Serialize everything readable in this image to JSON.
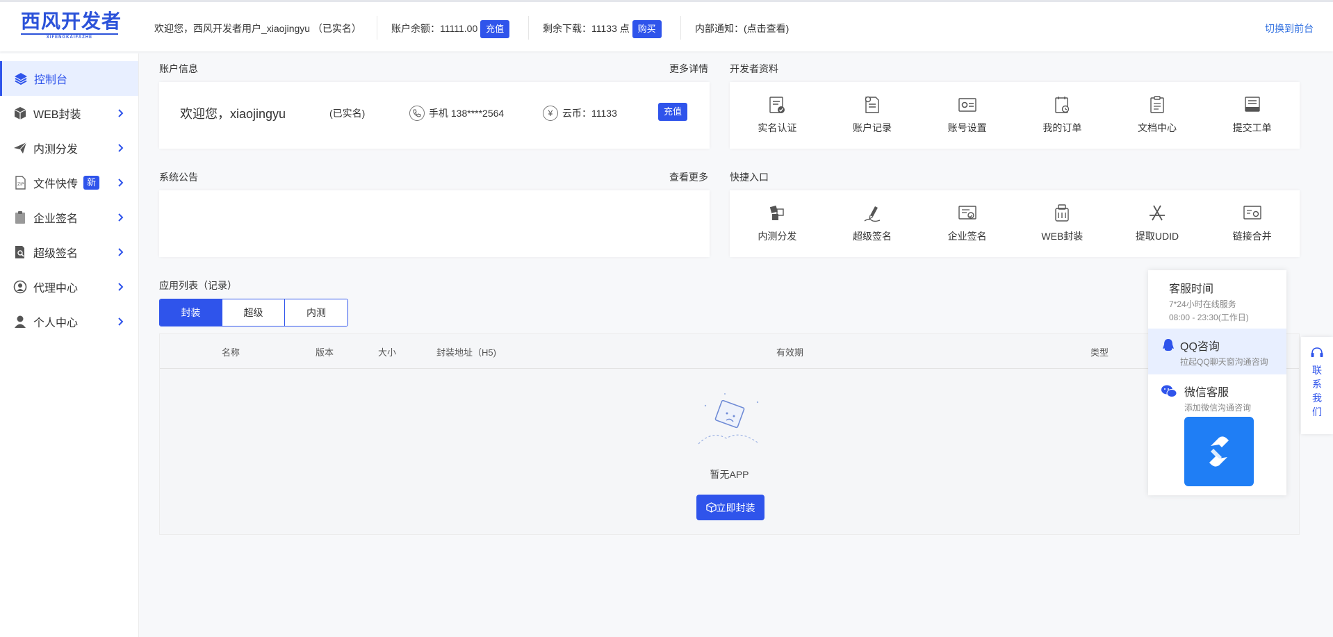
{
  "header": {
    "logo_title": "西风开发者",
    "logo_sub": "XIFENGKAIFAZHE",
    "welcome": "欢迎您，西风开发者用户_xiaojingyu （已实名）",
    "balance_label": "账户余额：11111.00",
    "recharge_btn": "充值",
    "downloads_label": "剩余下载：11133 点",
    "buy_btn": "购买",
    "notice": "内部通知：(点击查看)",
    "switch_front": "切换到前台"
  },
  "sidebar": {
    "items": [
      {
        "label": "控制台",
        "icon": "layers-icon"
      },
      {
        "label": "WEB封装",
        "icon": "box-icon"
      },
      {
        "label": "内测分发",
        "icon": "paper-plane-icon"
      },
      {
        "label": "文件快传",
        "icon": "file-transfer-icon",
        "badge": "新"
      },
      {
        "label": "企业签名",
        "icon": "clipboard-icon"
      },
      {
        "label": "超级签名",
        "icon": "document-search-icon"
      },
      {
        "label": "代理中心",
        "icon": "agent-icon"
      },
      {
        "label": "个人中心",
        "icon": "user-icon"
      }
    ]
  },
  "account": {
    "title": "账户信息",
    "more": "更多详情",
    "welcome": "欢迎您，xiaojingyu",
    "real": "(已实名)",
    "phone": "手机 138****2564",
    "coin": "云币：11133",
    "recharge": "充值"
  },
  "dev_profile": {
    "title": "开发者资料",
    "items": [
      {
        "label": "实名认证",
        "icon": "id-verify-icon"
      },
      {
        "label": "账户记录",
        "icon": "account-log-icon"
      },
      {
        "label": "账号设置",
        "icon": "account-settings-icon"
      },
      {
        "label": "我的订单",
        "icon": "order-icon"
      },
      {
        "label": "文档中心",
        "icon": "docs-icon"
      },
      {
        "label": "提交工单",
        "icon": "ticket-icon"
      }
    ]
  },
  "announcement": {
    "title": "系统公告",
    "more": "查看更多"
  },
  "quick": {
    "title": "快捷入口",
    "items": [
      {
        "label": "内测分发",
        "icon": "cubes-icon"
      },
      {
        "label": "超级签名",
        "icon": "pen-sign-icon"
      },
      {
        "label": "企业签名",
        "icon": "certificate-icon"
      },
      {
        "label": "WEB封装",
        "icon": "web-pack-icon"
      },
      {
        "label": "提取UDID",
        "icon": "app-store-icon"
      },
      {
        "label": "链接合并",
        "icon": "link-merge-icon"
      }
    ]
  },
  "apps": {
    "title": "应用列表（记录）",
    "tabs": [
      "封装",
      "超级",
      "内测"
    ],
    "columns": [
      "名称",
      "版本",
      "大小",
      "封装地址（H5)",
      "有效期",
      "类型"
    ],
    "empty_text": "暂无APP",
    "empty_button": "立即封装"
  },
  "support": {
    "hours_title": "客服时间",
    "hours_desc1": "7*24小时在线服务",
    "hours_desc2": "08:00 - 23:30(工作日)",
    "qq_title": "QQ咨询",
    "qq_desc": "拉起QQ聊天窗沟通咨询",
    "wx_title": "微信客服",
    "wx_desc": "添加微信沟通咨询",
    "contact": "联系我们"
  },
  "colors": {
    "accent": "#2f54eb",
    "link": "#2f6fe0"
  }
}
